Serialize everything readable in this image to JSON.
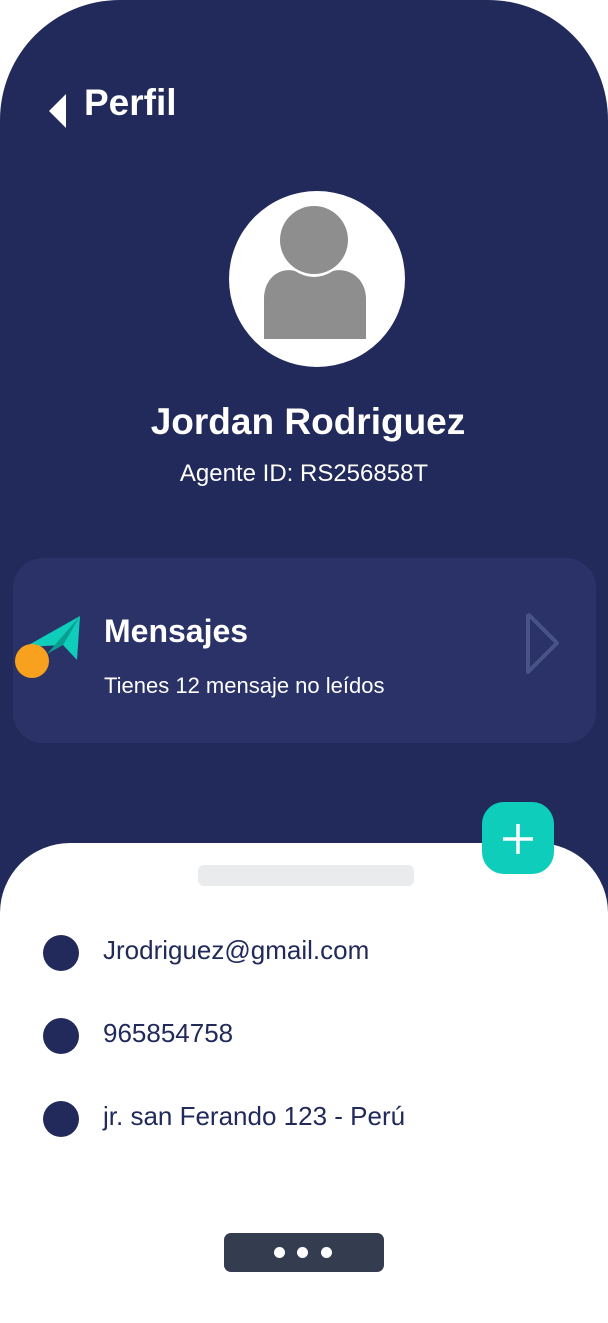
{
  "header": {
    "title": "Perfil",
    "back_icon": "chevron-left-icon"
  },
  "profile": {
    "avatar_icon": "user-avatar-icon",
    "name": "Jordan Rodriguez",
    "agent_id": "Agente ID: RS256858T"
  },
  "messages_card": {
    "icon": "paper-plane-icon",
    "title": "Mensajes",
    "subtitle": "Tienes 12 mensaje no leídos",
    "arrow_icon": "chevron-right-icon"
  },
  "fab": {
    "icon": "plus-icon"
  },
  "contact": {
    "items": [
      {
        "value": "Jrodriguez@gmail.com"
      },
      {
        "value": "965854758"
      },
      {
        "value": "jr. san Ferando 123 - Perú"
      }
    ]
  },
  "home_bar": {
    "icon": "more-dots-icon"
  },
  "colors": {
    "primary": "#212a5a",
    "card": "#2a3268",
    "accent": "#0ecdbb",
    "orange": "#f7a11e",
    "home_bar": "#333d4f"
  }
}
